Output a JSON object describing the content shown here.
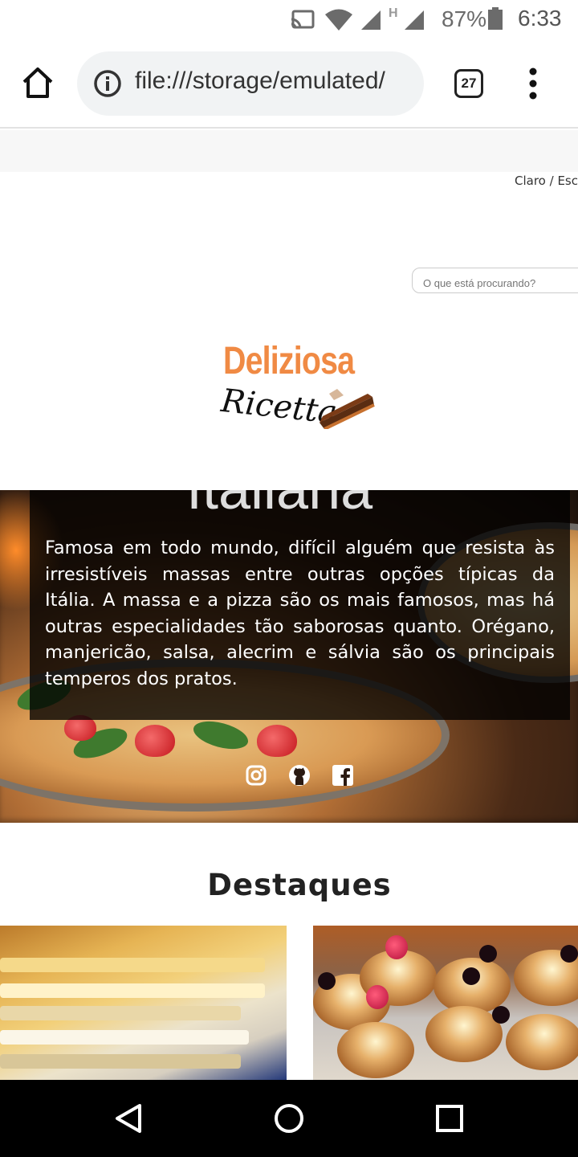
{
  "status_bar": {
    "network_label": "H",
    "battery": "87%",
    "time": "6:33"
  },
  "browser": {
    "url": "file:///storage/emulated/",
    "tab_count": "27"
  },
  "page": {
    "carrier_text": "Claro / Esc",
    "search_placeholder": "O que está procurando?",
    "logo": {
      "line1": "Deliziosa",
      "line2": "Ricetta"
    },
    "hero": {
      "heading": "Italiana",
      "description": "Famosa em todo mundo, difícil alguém que resista às irresistíveis massas entre outras opções típicas da Itália. A massa e a pizza são os mais famosos, mas há outras especialidades tão saborosas quanto. Orégano, manjericão, salsa, alecrim e sálvia são os principais temperos dos pratos.",
      "social": [
        "instagram-icon",
        "github-icon",
        "facebook-icon"
      ]
    },
    "section_title": "Destaques",
    "cards": [
      "lasagna",
      "cream-puffs"
    ]
  },
  "colors": {
    "brand_orange": "#f08a44",
    "overlay": "#000000"
  }
}
